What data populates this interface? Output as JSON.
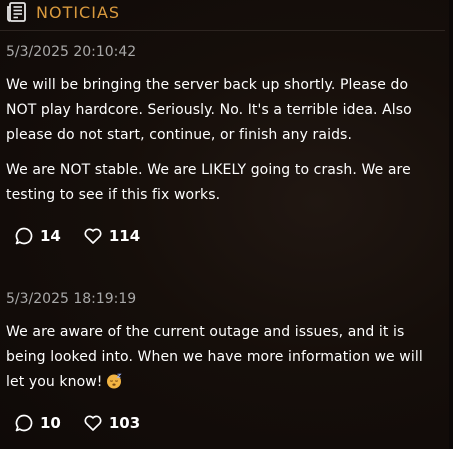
{
  "header": {
    "icon": "newspaper-icon",
    "title": "NOTICIAS",
    "accent_color": "#d99a3e"
  },
  "posts": [
    {
      "timestamp": "5/3/2025 20:10:42",
      "paragraphs": [
        "We will be bringing the server back up shortly. Please do NOT play hardcore. Seriously. No. It's a terrible idea. Also please do not start, continue, or finish any raids.",
        "We are NOT stable. We are LIKELY going to crash. We are testing to see if this fix works."
      ],
      "comments": "14",
      "likes": "114"
    },
    {
      "timestamp": "5/3/2025 18:19:19",
      "paragraphs": [
        "We are aware of the current outage and issues, and it is being looked into. When we have more information we will let you know!"
      ],
      "emoji": "sleeping-face-emoji",
      "comments": "10",
      "likes": "103"
    }
  ]
}
